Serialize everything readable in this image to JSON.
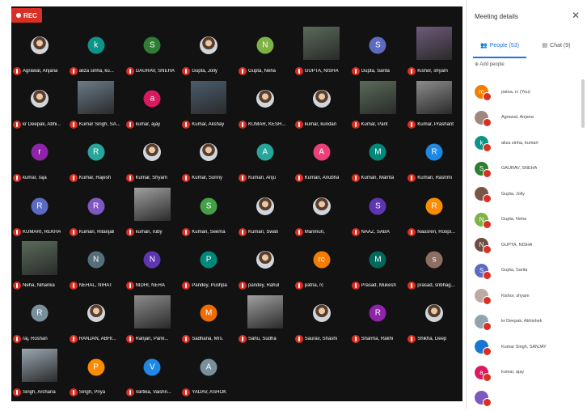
{
  "recording": {
    "label": "REC"
  },
  "tiles": [
    {
      "name": "Agrawal, Anjana",
      "kind": "photo"
    },
    {
      "name": "aliza sinha, ku...",
      "kind": "avatar",
      "initial": "k",
      "color": "#0d9488"
    },
    {
      "name": "GAURAV, SNEHA",
      "kind": "avatar",
      "initial": "S",
      "color": "#2e7d32"
    },
    {
      "name": "Gupta, Jolly",
      "kind": "photo"
    },
    {
      "name": "Gupta, Neha",
      "kind": "avatar",
      "initial": "N",
      "color": "#7cb342"
    },
    {
      "name": "GUPTA, NISHA",
      "kind": "video"
    },
    {
      "name": "Gupta, Sarita",
      "kind": "avatar",
      "initial": "S",
      "color": "#5c6bc0"
    },
    {
      "name": "Kishor, shyam",
      "kind": "video"
    },
    {
      "name": "kr Deepak, Abhi...",
      "kind": "photo"
    },
    {
      "name": "Kumar Singh, SA...",
      "kind": "video"
    },
    {
      "name": "kumar, ajay",
      "kind": "avatar",
      "initial": "a",
      "color": "#d81b60"
    },
    {
      "name": "Kumar, Akshay",
      "kind": "video"
    },
    {
      "name": "KUMAR, KESH...",
      "kind": "photo"
    },
    {
      "name": "kumar, kundan",
      "kind": "photo"
    },
    {
      "name": "Kumar, Pant",
      "kind": "video"
    },
    {
      "name": "Kumar, Prashant",
      "kind": "video"
    },
    {
      "name": "kumar, raja",
      "kind": "avatar",
      "initial": "r",
      "color": "#8e24aa"
    },
    {
      "name": "Kumar, Rajesh",
      "kind": "avatar",
      "initial": "R",
      "color": "#26a69a"
    },
    {
      "name": "Kumar, Shyam",
      "kind": "photo"
    },
    {
      "name": "Kumar, Sunny",
      "kind": "photo"
    },
    {
      "name": "Kumari, Anju",
      "kind": "avatar",
      "initial": "A",
      "color": "#26a69a"
    },
    {
      "name": "Kumari, Anubha",
      "kind": "avatar",
      "initial": "A",
      "color": "#ec407a"
    },
    {
      "name": "Kumari, Mamta",
      "kind": "avatar",
      "initial": "M",
      "color": "#00897b"
    },
    {
      "name": "Kumari, Rashmi",
      "kind": "avatar",
      "initial": "R",
      "color": "#1e88e5"
    },
    {
      "name": "KUMARI, REKHA",
      "kind": "avatar",
      "initial": "R",
      "color": "#5c6bc0"
    },
    {
      "name": "Kumari, Ritanjali",
      "kind": "avatar",
      "initial": "R",
      "color": "#7e57c2"
    },
    {
      "name": "kumari, ruby",
      "kind": "video"
    },
    {
      "name": "Kumari, Seema",
      "kind": "avatar",
      "initial": "S",
      "color": "#43a047"
    },
    {
      "name": "Kumari, Swati",
      "kind": "photo"
    },
    {
      "name": "Manmun,",
      "kind": "photo"
    },
    {
      "name": "NAAZ, SABA",
      "kind": "avatar",
      "initial": "S",
      "color": "#5e35b1"
    },
    {
      "name": "Nausren, Roopi...",
      "kind": "avatar",
      "initial": "R",
      "color": "#fb8c00"
    },
    {
      "name": "Neha, Niharika",
      "kind": "video"
    },
    {
      "name": "NEHAL, NIHAT",
      "kind": "avatar",
      "initial": "N",
      "color": "#546e7a"
    },
    {
      "name": "NIDHI, NEHA",
      "kind": "avatar",
      "initial": "N",
      "color": "#5e35b1"
    },
    {
      "name": "Pandey, Pushpa",
      "kind": "avatar",
      "initial": "P",
      "color": "#00897b"
    },
    {
      "name": "pandey, Rahul",
      "kind": "photo"
    },
    {
      "name": "patna, rc",
      "kind": "avatar",
      "initial": "rc",
      "color": "#f57c00"
    },
    {
      "name": "Prasad, Mukesh",
      "kind": "avatar",
      "initial": "M",
      "color": "#00695c"
    },
    {
      "name": "prasad, sribhag...",
      "kind": "avatar",
      "initial": "s",
      "color": "#8d6e63"
    },
    {
      "name": "raj, Roshan",
      "kind": "avatar",
      "initial": "R",
      "color": "#78909c"
    },
    {
      "name": "RANJAN, ABHI...",
      "kind": "photo"
    },
    {
      "name": "Ranjan, Pank...",
      "kind": "video"
    },
    {
      "name": "Sadhana, Mrs.",
      "kind": "avatar",
      "initial": "M",
      "color": "#ef6c00"
    },
    {
      "name": "Sahu, Sudha",
      "kind": "video"
    },
    {
      "name": "Saurav, Shashi",
      "kind": "photo"
    },
    {
      "name": "Sharma, Rakhi",
      "kind": "avatar",
      "initial": "R",
      "color": "#8e24aa"
    },
    {
      "name": "Shikha, Deep",
      "kind": "photo"
    },
    {
      "name": "Singh, Archana",
      "kind": "video"
    },
    {
      "name": "Singh, Priya",
      "kind": "avatar",
      "initial": "P",
      "color": "#fb8c00"
    },
    {
      "name": "Vartika, Vaishn...",
      "kind": "avatar",
      "initial": "V",
      "color": "#1e88e5"
    },
    {
      "name": "YADAV, ASHOK",
      "kind": "avatar",
      "initial": "A",
      "color": "#78909c"
    }
  ],
  "panel": {
    "title": "Meeting details",
    "close_icon": "close-icon",
    "tab_people": "People (53)",
    "tab_chat": "Chat (9)",
    "add_people": "Add people",
    "participants": [
      {
        "name": "patna, rc (You)",
        "initial": "rc",
        "color": "#f57c00"
      },
      {
        "name": "Agrawal, Anjana",
        "initial": "",
        "color": "#a1887f"
      },
      {
        "name": "aliza sinha, kumari",
        "initial": "k",
        "color": "#0d9488"
      },
      {
        "name": "GAURAV, SNEHA",
        "initial": "S",
        "color": "#2e7d32"
      },
      {
        "name": "Gupta, Jolly",
        "initial": "",
        "color": "#795548"
      },
      {
        "name": "Gupta, Neha",
        "initial": "N",
        "color": "#7cb342"
      },
      {
        "name": "GUPTA, NISHA",
        "initial": "N",
        "color": "#6d4c41"
      },
      {
        "name": "Gupta, Sarita",
        "initial": "S",
        "color": "#5c6bc0"
      },
      {
        "name": "Kishor, shyam",
        "initial": "",
        "color": "#bcaaa4"
      },
      {
        "name": "kr Deepak, Abhishek",
        "initial": "",
        "color": "#90a4ae"
      },
      {
        "name": "Kumar Singh, SANJAY",
        "initial": "",
        "color": "#1976d2"
      },
      {
        "name": "kumar, ajay",
        "initial": "a",
        "color": "#d81b60"
      },
      {
        "name": "",
        "initial": "",
        "color": "#7e57c2"
      }
    ]
  }
}
